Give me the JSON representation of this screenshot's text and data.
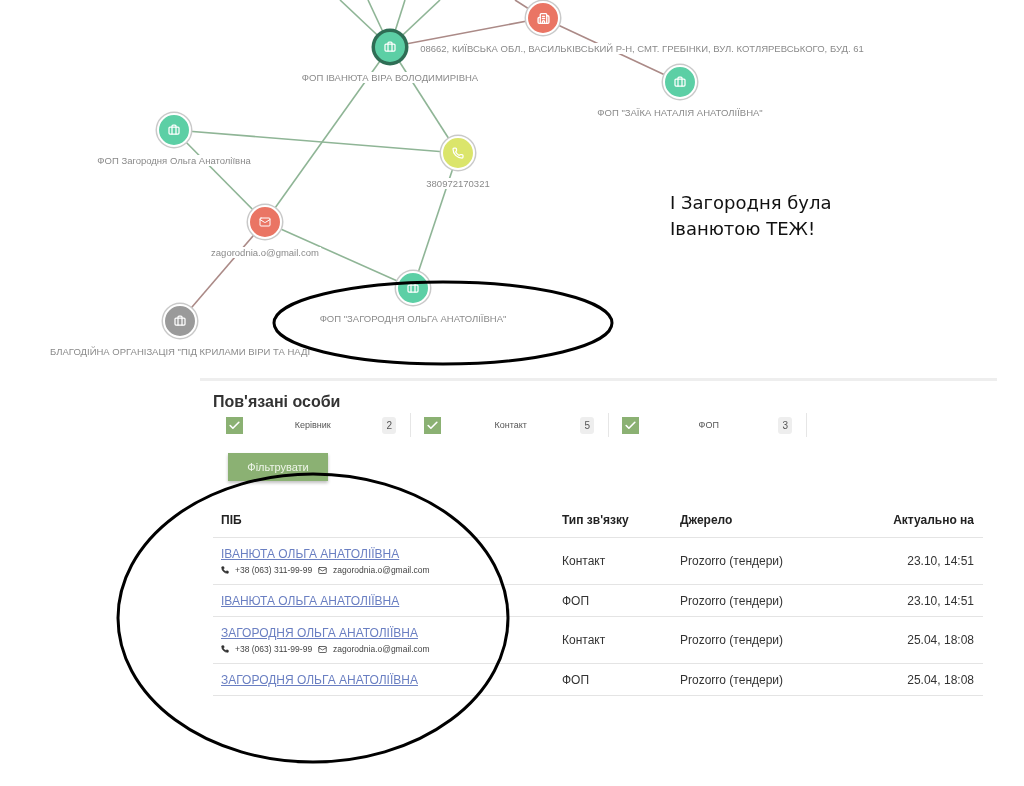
{
  "graph": {
    "nodes": [
      {
        "kind": "building",
        "color": "#ea7564",
        "selected": false,
        "label": "08662, КИЇВСЬКА ОБЛ., ВАСИЛЬКІВСЬКИЙ Р-Н, СМТ. ГРЕБІНКИ, ВУЛ. КОТЛЯРЕВСЬКОГО, БУД. 61"
      },
      {
        "kind": "briefcase",
        "color": "#5ccfa5",
        "selected": true,
        "label": "ФОП ІВАНЮТА ВІРА ВОЛОДИМИРІВНА"
      },
      {
        "kind": "briefcase",
        "color": "#5ccfa5",
        "selected": false,
        "label": "ФОП \"ЗАЇКА НАТАЛІЯ АНАТОЛІЇВНА\""
      },
      {
        "kind": "briefcase",
        "color": "#5ccfa5",
        "selected": false,
        "label": "ФОП Загородня Ольга Анатоліївна"
      },
      {
        "kind": "phone",
        "color": "#dbe56b",
        "selected": false,
        "label": "380972170321"
      },
      {
        "kind": "email",
        "color": "#ea7564",
        "selected": false,
        "label": "zagorodnia.o@gmail.com"
      },
      {
        "kind": "briefcase",
        "color": "#5ccfa5",
        "selected": false,
        "label": "ФОП \"ЗАГОРОДНЯ ОЛЬГА АНАТОЛІЇВНА\""
      },
      {
        "kind": "briefcase",
        "color": "#9a9a9a",
        "selected": false,
        "label": "БЛАГОДІЙНА ОРГАНІЗАЦІЯ \"ПІД КРИЛАМИ ВІРИ ТА НАДІ"
      }
    ]
  },
  "note": [
    "І Загородня була",
    "Іванютою ТЕЖ!"
  ],
  "related": {
    "title": "Пов'язані особи",
    "filters": [
      {
        "label": "Керівник",
        "count": "2",
        "checked": true
      },
      {
        "label": "Контакт",
        "count": "5",
        "checked": true
      },
      {
        "label": "ФОП",
        "count": "3",
        "checked": true
      }
    ],
    "button": "Фільтрувати",
    "columns": [
      "ПІБ",
      "Тип зв'язку",
      "Джерело",
      "Актуально на"
    ],
    "rows": [
      {
        "name": "ІВАНЮТА ОЛЬГА АНАТОЛІЇВНА",
        "phone": "+38 (063) 311-99-99",
        "email": "zagorodnia.o@gmail.com",
        "type": "Контакт",
        "source": "Prozorro (тендери)",
        "date": "23.10, 14:51"
      },
      {
        "name": "ІВАНЮТА ОЛЬГА АНАТОЛІЇВНА",
        "type": "ФОП",
        "source": "Prozorro (тендери)",
        "date": "23.10, 14:51"
      },
      {
        "name": "ЗАГОРОДНЯ ОЛЬГА АНАТОЛІЇВНА",
        "phone": "+38 (063) 311-99-99",
        "email": "zagorodnia.o@gmail.com",
        "type": "Контакт",
        "source": "Prozorro (тендери)",
        "date": "25.04, 18:08"
      },
      {
        "name": "ЗАГОРОДНЯ ОЛЬГА АНАТОЛІЇВНА",
        "type": "ФОП",
        "source": "Prozorro (тендери)",
        "date": "25.04, 18:08"
      }
    ]
  }
}
